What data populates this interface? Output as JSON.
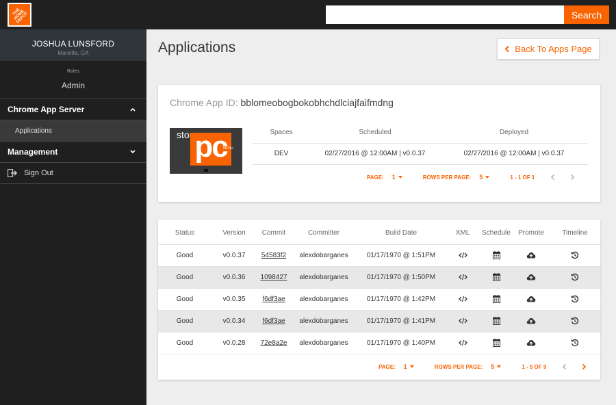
{
  "header": {
    "logo_text": "THE\nHOME\nDEPOT",
    "search_value": "",
    "search_label": "Search"
  },
  "sidebar": {
    "user_name": "JOSHUA LUNSFORD",
    "user_location": "Marietta, GA",
    "roles_label": "Roles",
    "role": "Admin",
    "sections": [
      {
        "label": "Chrome App Server",
        "expanded": true,
        "items": [
          {
            "label": "Applications"
          }
        ]
      },
      {
        "label": "Management",
        "expanded": false,
        "items": []
      }
    ],
    "sign_out": "Sign Out"
  },
  "main": {
    "title": "Applications",
    "back_label": "Back To Apps Page",
    "app": {
      "id_label": "Chrome App ID: ",
      "id_value": "bblomeobogbokobhchdlciajfaifmdng",
      "icon_text": {
        "store": "store",
        "pc": "pc",
        "menu": "MENU"
      },
      "columns": [
        "Spaces",
        "Scheduled",
        "Deployed"
      ],
      "rows": [
        {
          "space": "DEV",
          "scheduled": "02/27/2016 @ 12:00AM | v0.0.37",
          "deployed": "02/27/2016 @ 12:00AM | v0.0.37"
        }
      ],
      "pager": {
        "page_label": "PAGE:",
        "page": "1",
        "rows_label": "ROWS PER PAGE:",
        "rows": "5",
        "range": "1 - 1 OF 1"
      }
    },
    "builds": {
      "columns": [
        "Status",
        "Version",
        "Commit",
        "Committer",
        "Build Date",
        "XML",
        "Schedule",
        "Promote",
        "Timeline"
      ],
      "rows": [
        {
          "status": "Good",
          "version": "v0.0.37",
          "commit": "54583f2",
          "committer": "alexdobarganes",
          "date": "01/17/1970 @ 1:51PM"
        },
        {
          "status": "Good",
          "version": "v0.0.36",
          "commit": "1098427",
          "committer": "alexdobarganes",
          "date": "01/17/1970 @ 1:50PM"
        },
        {
          "status": "Good",
          "version": "v0.0.35",
          "commit": "f6df3ae",
          "committer": "alexdobarganes",
          "date": "01/17/1970 @ 1:42PM"
        },
        {
          "status": "Good",
          "version": "v0.0.34",
          "commit": "f6df3ae",
          "committer": "alexdobarganes",
          "date": "01/17/1970 @ 1:41PM"
        },
        {
          "status": "Good",
          "version": "v0.0.28",
          "commit": "72e8a2e",
          "committer": "alexdobarganes",
          "date": "01/17/1970 @ 1:40PM"
        }
      ],
      "pager": {
        "page_label": "PAGE:",
        "page": "1",
        "rows_label": "ROWS PER PAGE:",
        "rows": "5",
        "range": "1 - 5 OF 9"
      }
    }
  },
  "icons": {
    "logo": "home-depot-logo",
    "back": "chevron-left-icon",
    "expand": "chevron-up-icon",
    "collapse": "chevron-down-icon",
    "sign_out": "sign-out-icon",
    "xml": "code-icon",
    "schedule": "calendar-icon",
    "promote": "cloud-upload-icon",
    "timeline": "history-icon",
    "prev": "chevron-left-icon",
    "next": "chevron-right-icon"
  },
  "colors": {
    "accent": "#f96302",
    "topbar": "#202020",
    "sidebar": "#1f1f1f",
    "user_box": "#2e353b"
  }
}
